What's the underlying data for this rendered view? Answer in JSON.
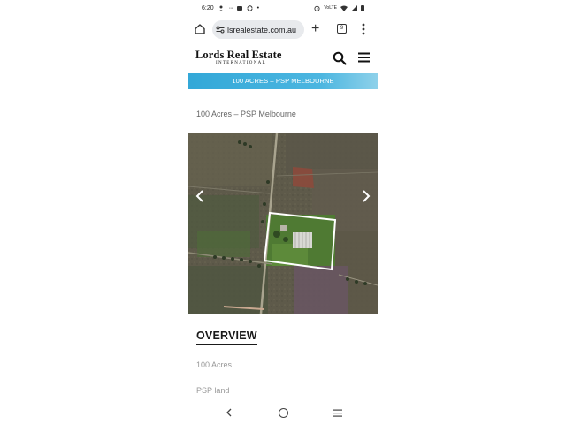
{
  "status_bar": {
    "time": "6:20",
    "left_icons": [
      "person-alert-icon",
      "dots-icon",
      "mail-icon",
      "sync-icon",
      "dot-icon"
    ],
    "right_icons": [
      "alarm-icon",
      "volte-icon",
      "wifi-icon",
      "signal-icon",
      "battery-icon"
    ]
  },
  "browser": {
    "url": "lsrealestate.com.au",
    "tab_count": "9"
  },
  "site": {
    "logo_main": "Lords Real Estate",
    "logo_sub": "INTERNATIONAL",
    "banner": "100 ACRES – PSP MELBOURNE"
  },
  "listing": {
    "heading": "100 Acres – PSP Melbourne",
    "photo_alt": "Aerial view of property",
    "overview_title": "OVERVIEW",
    "overview_items": [
      "100 Acres",
      "PSP land"
    ]
  },
  "colors": {
    "banner": "#3aaee0",
    "highlight_box": "#ffffff"
  }
}
